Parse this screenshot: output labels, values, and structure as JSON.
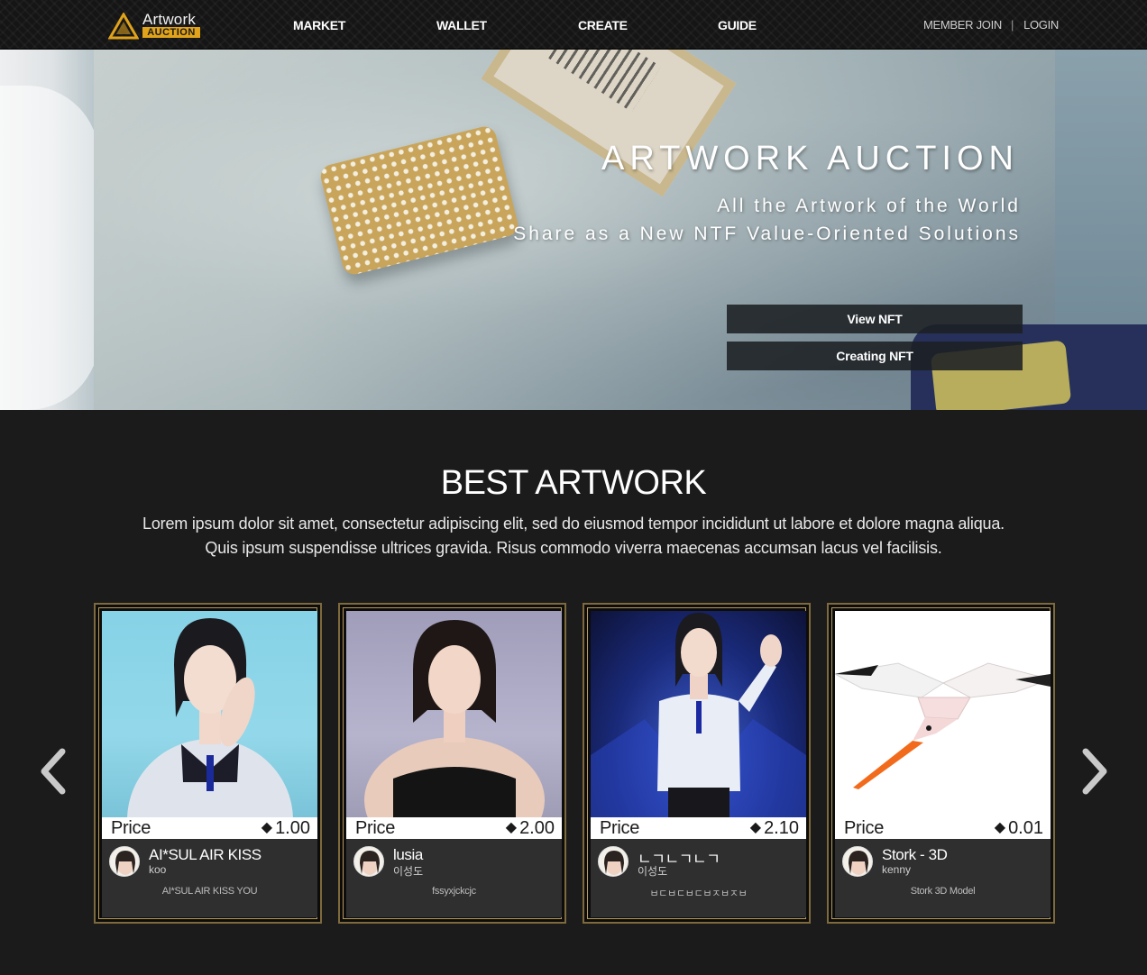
{
  "header": {
    "logo_word": "Artwork",
    "logo_sub": "AUCTION",
    "nav": [
      "MARKET",
      "WALLET",
      "CREATE",
      "GUIDE"
    ],
    "member_join": "MEMBER JOIN",
    "separator": "|",
    "login": "LOGIN"
  },
  "hero": {
    "title": "ARTWORK AUCTION",
    "subtitle_line1": "All the Artwork of the World",
    "subtitle_line2": "Share as a New NTF Value-Oriented Solutions",
    "btn_view": "View NFT",
    "btn_create": "Creating NFT"
  },
  "best": {
    "title": "BEST ARTWORK",
    "desc_line1": "Lorem ipsum dolor sit amet, consectetur adipiscing elit, sed do eiusmod tempor incididunt ut labore et dolore magna aliqua.",
    "desc_line2": "Quis ipsum suspendisse ultrices gravida. Risus commodo viverra maecenas accumsan lacus vel facilisis.",
    "price_label": "Price",
    "currency_icon": "ethereum-icon",
    "cards": [
      {
        "price": "1.00",
        "name": "AI*SUL AIR KISS",
        "user": "koo",
        "desc": "AI*SUL AIR KISS YOU"
      },
      {
        "price": "2.00",
        "name": "lusia",
        "user": "이성도",
        "desc": "fssyxjckcjc"
      },
      {
        "price": "2.10",
        "name": "ㄴㄱㄴㄱㄴㄱ",
        "user": "이성도",
        "desc": "ㅂㄷㅂㄷㅂㄷㅂㅈㅂㅈㅂ"
      },
      {
        "price": "0.01",
        "name": "Stork - 3D",
        "user": "kenny",
        "desc": "Stork 3D Model"
      }
    ]
  },
  "colors": {
    "accent_gold": "#e0a31a",
    "card_border": "#b89a58",
    "page_bg": "#1b1b1b"
  }
}
